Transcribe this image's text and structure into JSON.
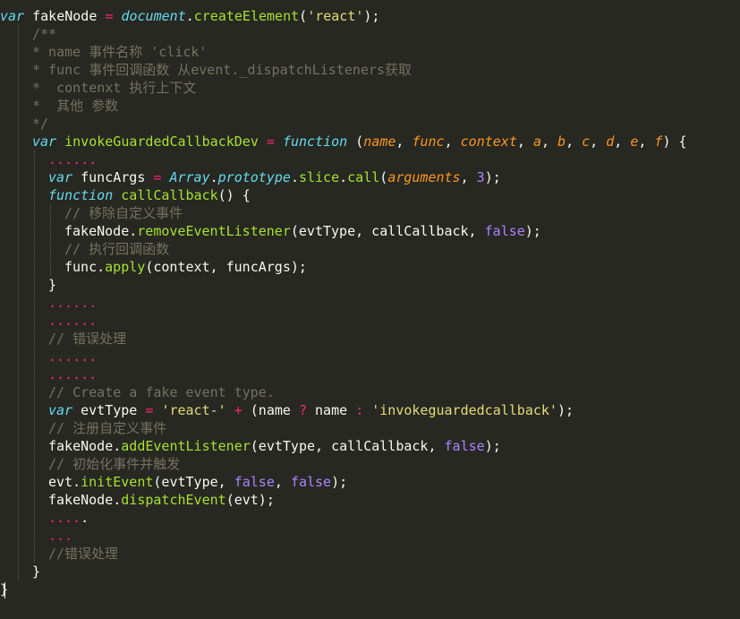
{
  "editor": {
    "theme_colors": {
      "background": "#272822",
      "text": "#f8f8f2",
      "keyword": "#66d9ef",
      "operator": "#f92672",
      "function": "#a6e22e",
      "string": "#e6db74",
      "number": "#ae81ff",
      "parameter": "#fd971f",
      "comment": "#75715e"
    },
    "lines": [
      {
        "indent": 0,
        "tokens": [
          [
            "kw",
            "var"
          ],
          [
            "plain",
            " fakeNode "
          ],
          [
            "op",
            "="
          ],
          [
            "plain",
            " "
          ],
          [
            "builtin",
            "document"
          ],
          [
            "plain",
            "."
          ],
          [
            "fn",
            "createElement"
          ],
          [
            "plain",
            "("
          ],
          [
            "str",
            "'react'"
          ],
          [
            "plain",
            ");"
          ]
        ]
      },
      {
        "indent": 2,
        "tokens": [
          [
            "cmt",
            "/**"
          ]
        ]
      },
      {
        "indent": 2,
        "tokens": [
          [
            "cmt",
            "* name 事件名称 'click'"
          ]
        ]
      },
      {
        "indent": 2,
        "tokens": [
          [
            "cmt",
            "* func 事件回调函数 从event._dispatchListeners获取"
          ]
        ]
      },
      {
        "indent": 2,
        "tokens": [
          [
            "cmt",
            "*  contenxt 执行上下文"
          ]
        ]
      },
      {
        "indent": 2,
        "tokens": [
          [
            "cmt",
            "*  其他 参数"
          ]
        ]
      },
      {
        "indent": 2,
        "tokens": [
          [
            "cmt",
            "*/"
          ]
        ]
      },
      {
        "indent": 2,
        "tokens": [
          [
            "kw",
            "var"
          ],
          [
            "plain",
            " "
          ],
          [
            "fn",
            "invokeGuardedCallbackDev"
          ],
          [
            "plain",
            " "
          ],
          [
            "op",
            "="
          ],
          [
            "plain",
            " "
          ],
          [
            "kw",
            "function"
          ],
          [
            "plain",
            " ("
          ],
          [
            "param",
            "name"
          ],
          [
            "plain",
            ", "
          ],
          [
            "param",
            "func"
          ],
          [
            "plain",
            ", "
          ],
          [
            "param",
            "context"
          ],
          [
            "plain",
            ", "
          ],
          [
            "param",
            "a"
          ],
          [
            "plain",
            ", "
          ],
          [
            "param",
            "b"
          ],
          [
            "plain",
            ", "
          ],
          [
            "param",
            "c"
          ],
          [
            "plain",
            ", "
          ],
          [
            "param",
            "d"
          ],
          [
            "plain",
            ", "
          ],
          [
            "param",
            "e"
          ],
          [
            "plain",
            ", "
          ],
          [
            "param",
            "f"
          ],
          [
            "plain",
            ") {"
          ]
        ]
      },
      {
        "indent": 3,
        "tokens": [
          [
            "dots",
            "......"
          ]
        ]
      },
      {
        "indent": 3,
        "tokens": [
          [
            "kw",
            "var"
          ],
          [
            "plain",
            " funcArgs "
          ],
          [
            "op",
            "="
          ],
          [
            "plain",
            " "
          ],
          [
            "builtin",
            "Array"
          ],
          [
            "plain",
            "."
          ],
          [
            "builtin",
            "prototype"
          ],
          [
            "plain",
            "."
          ],
          [
            "fn",
            "slice"
          ],
          [
            "plain",
            "."
          ],
          [
            "fn",
            "call"
          ],
          [
            "plain",
            "("
          ],
          [
            "param",
            "arguments"
          ],
          [
            "plain",
            ", "
          ],
          [
            "num",
            "3"
          ],
          [
            "plain",
            ");"
          ]
        ]
      },
      {
        "indent": 3,
        "tokens": [
          [
            "kw",
            "function"
          ],
          [
            "plain",
            " "
          ],
          [
            "fn",
            "callCallback"
          ],
          [
            "plain",
            "() {"
          ]
        ]
      },
      {
        "indent": 4,
        "tokens": [
          [
            "cmt",
            "// 移除自定义事件"
          ]
        ]
      },
      {
        "indent": 4,
        "tokens": [
          [
            "plain",
            "fakeNode."
          ],
          [
            "fn",
            "removeEventListener"
          ],
          [
            "plain",
            "(evtType, callCallback, "
          ],
          [
            "const",
            "false"
          ],
          [
            "plain",
            ");"
          ]
        ]
      },
      {
        "indent": 4,
        "tokens": [
          [
            "cmt",
            "// 执行回调函数"
          ]
        ]
      },
      {
        "indent": 4,
        "tokens": [
          [
            "plain",
            "func."
          ],
          [
            "fn",
            "apply"
          ],
          [
            "plain",
            "(context, funcArgs);"
          ]
        ]
      },
      {
        "indent": 3,
        "tokens": [
          [
            "plain",
            "}"
          ]
        ]
      },
      {
        "indent": 3,
        "tokens": [
          [
            "dots",
            "......"
          ]
        ]
      },
      {
        "indent": 3,
        "tokens": [
          [
            "dots",
            "......"
          ]
        ]
      },
      {
        "indent": 3,
        "tokens": [
          [
            "cmt",
            "// 错误处理"
          ]
        ]
      },
      {
        "indent": 3,
        "tokens": [
          [
            "dots",
            "......"
          ]
        ]
      },
      {
        "indent": 3,
        "tokens": [
          [
            "dots",
            "......"
          ]
        ]
      },
      {
        "indent": 3,
        "tokens": [
          [
            "cmt",
            "// Create a fake event type."
          ]
        ]
      },
      {
        "indent": 3,
        "tokens": [
          [
            "kw",
            "var"
          ],
          [
            "plain",
            " evtType "
          ],
          [
            "op",
            "="
          ],
          [
            "plain",
            " "
          ],
          [
            "str",
            "'react-'"
          ],
          [
            "plain",
            " "
          ],
          [
            "op",
            "+"
          ],
          [
            "plain",
            " (name "
          ],
          [
            "op",
            "?"
          ],
          [
            "plain",
            " name "
          ],
          [
            "op",
            ":"
          ],
          [
            "plain",
            " "
          ],
          [
            "str",
            "'invokeguardedcallback'"
          ],
          [
            "plain",
            ");"
          ]
        ]
      },
      {
        "indent": 3,
        "tokens": [
          [
            "cmt",
            "// 注册自定义事件"
          ]
        ]
      },
      {
        "indent": 3,
        "tokens": [
          [
            "plain",
            "fakeNode."
          ],
          [
            "fn",
            "addEventListener"
          ],
          [
            "plain",
            "(evtType, callCallback, "
          ],
          [
            "const",
            "false"
          ],
          [
            "plain",
            ");"
          ]
        ]
      },
      {
        "indent": 3,
        "tokens": [
          [
            "cmt",
            "// 初始化事件并触发"
          ]
        ]
      },
      {
        "indent": 3,
        "tokens": [
          [
            "plain",
            "evt."
          ],
          [
            "fn",
            "initEvent"
          ],
          [
            "plain",
            "(evtType, "
          ],
          [
            "const",
            "false"
          ],
          [
            "plain",
            ", "
          ],
          [
            "const",
            "false"
          ],
          [
            "plain",
            ");"
          ]
        ]
      },
      {
        "indent": 3,
        "tokens": [
          [
            "plain",
            "fakeNode."
          ],
          [
            "fn",
            "dispatchEvent"
          ],
          [
            "plain",
            "(evt);"
          ]
        ]
      },
      {
        "indent": 3,
        "tokens": [
          [
            "dots",
            "...."
          ],
          [
            "plain",
            "."
          ]
        ]
      },
      {
        "indent": 3,
        "tokens": [
          [
            "dots",
            "..."
          ]
        ]
      },
      {
        "indent": 3,
        "tokens": [
          [
            "cmt",
            "//错误处理"
          ]
        ]
      },
      {
        "indent": 2,
        "tokens": [
          [
            "plain",
            "}"
          ]
        ]
      },
      {
        "indent": 0,
        "tokens": [
          [
            "plain",
            "}"
          ]
        ]
      }
    ]
  }
}
